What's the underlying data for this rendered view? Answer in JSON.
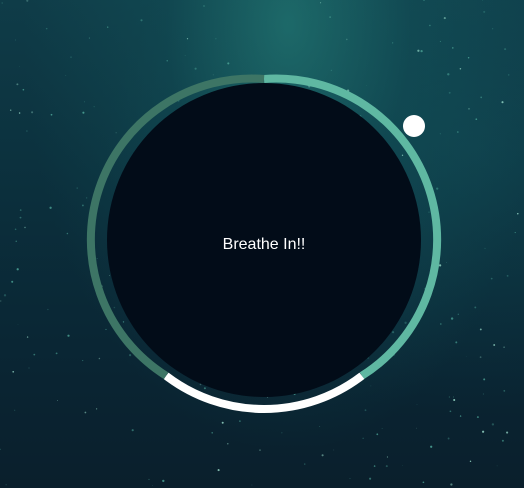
{
  "breathing": {
    "instruction": "Breathe In!!"
  },
  "colors": {
    "inner_circle": "#020c18",
    "segment_breathe_in": "#5fb8a2",
    "segment_hold": "#ffffff",
    "segment_breathe_out": "#3d7565",
    "pointer": "#ffffff"
  }
}
